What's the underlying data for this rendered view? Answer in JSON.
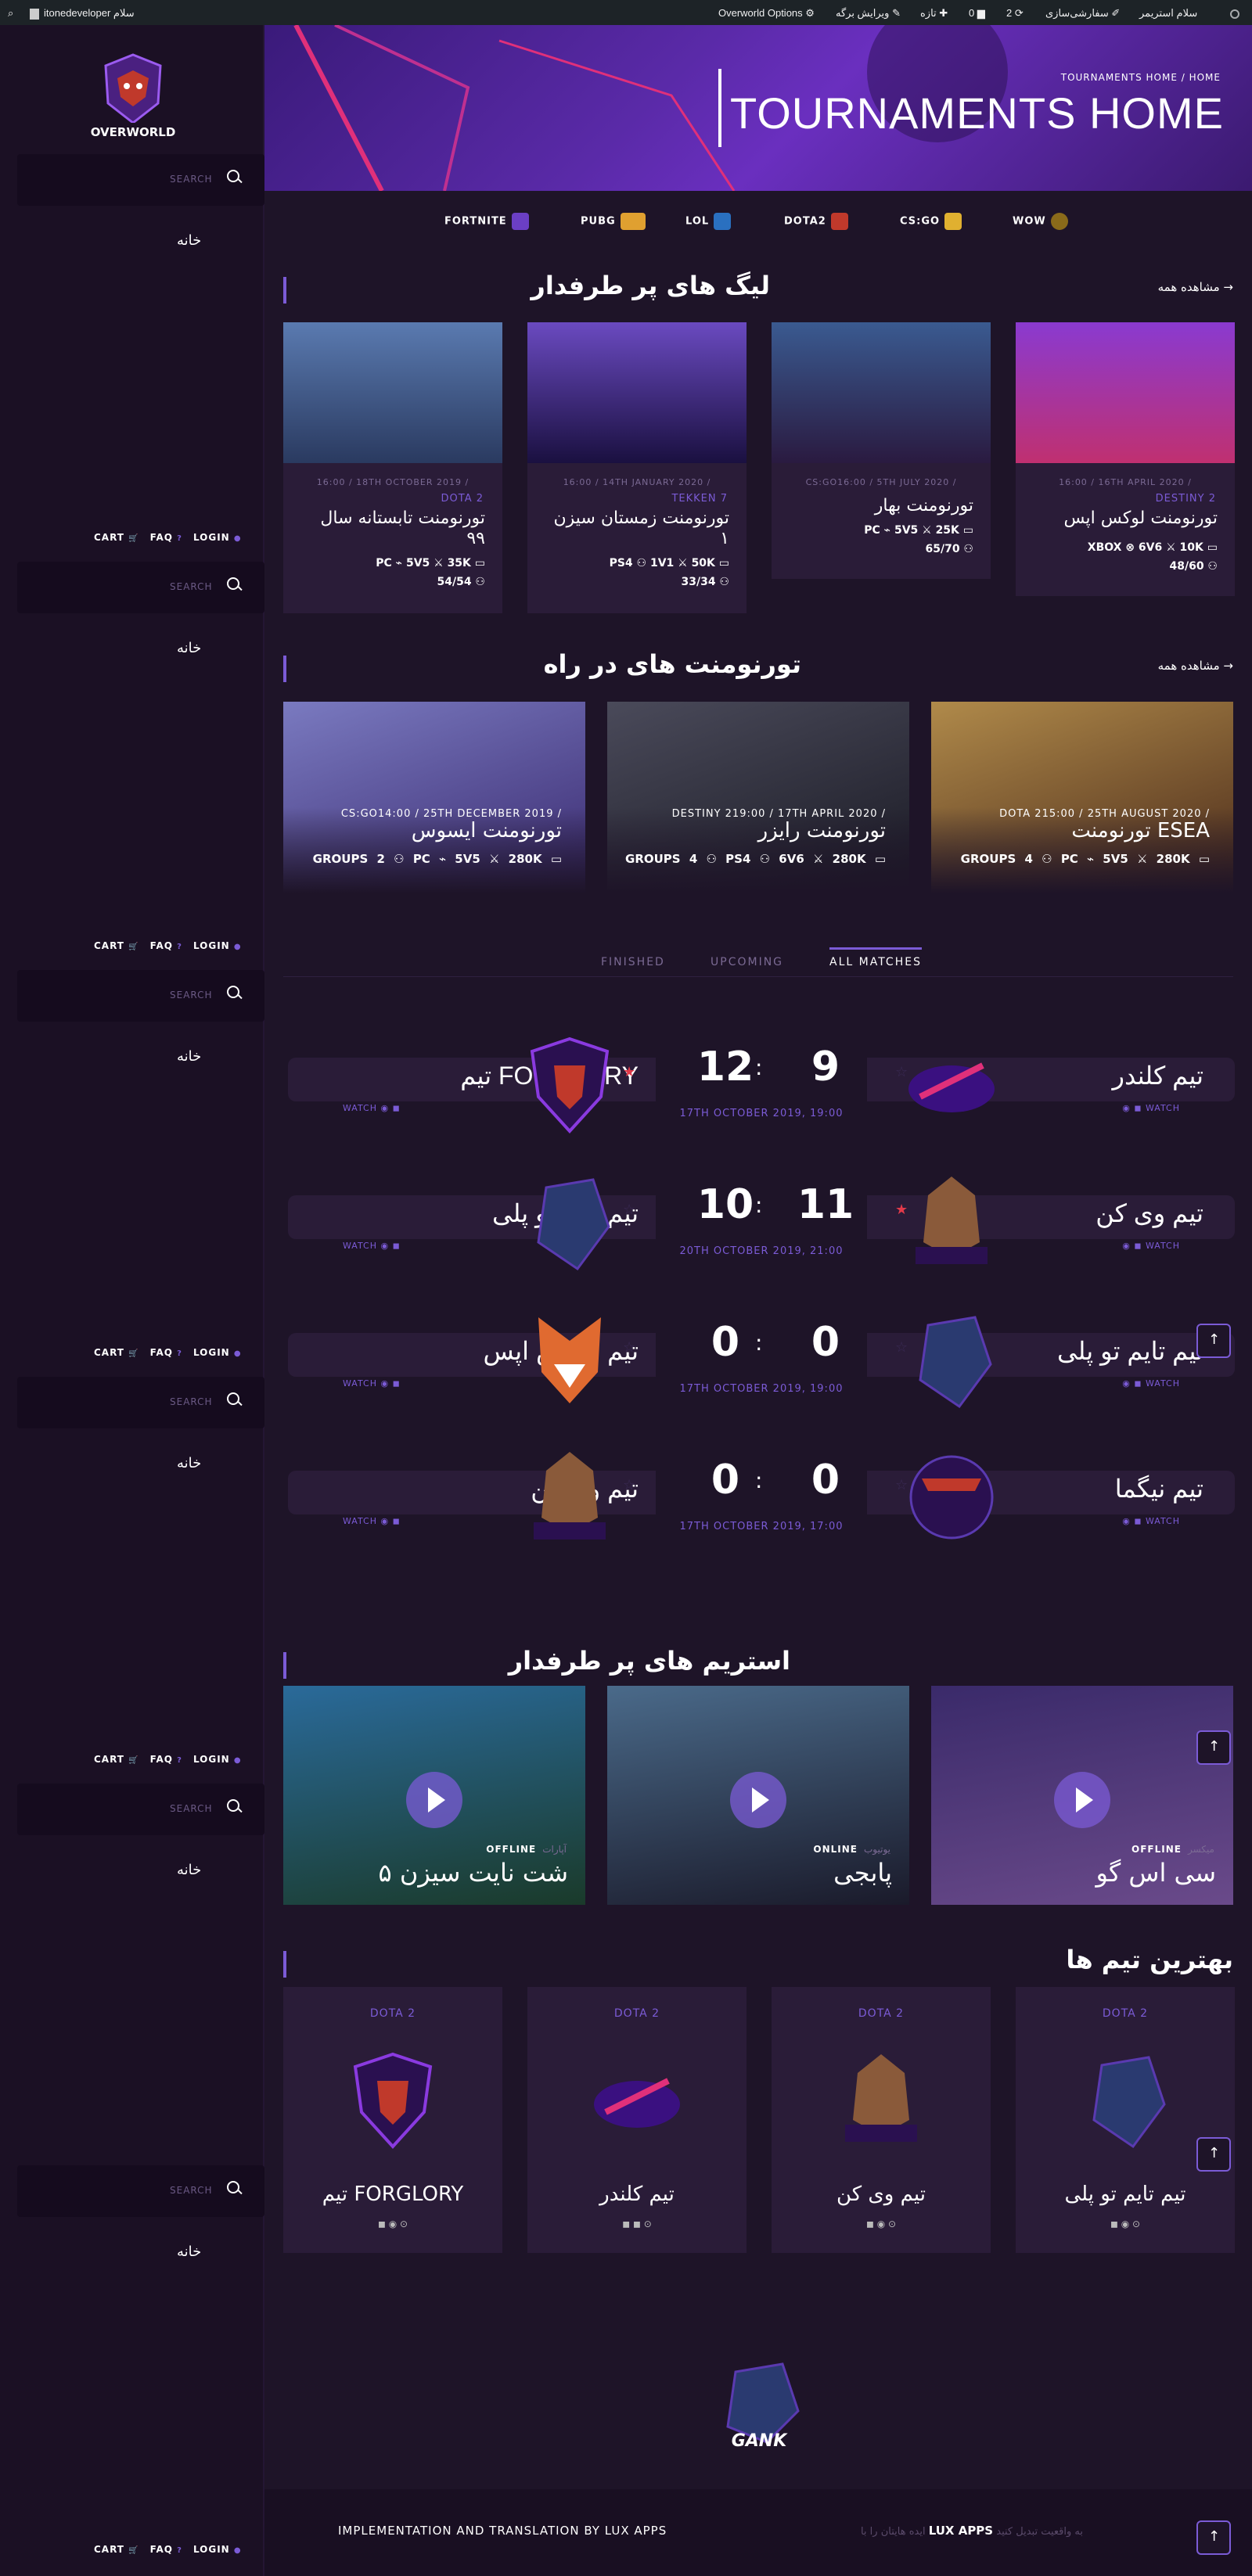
{
  "adminbar": {
    "site": "itonedeveloper سلام",
    "options": "Overworld Options",
    "edit": "ویرایش برگه",
    "new": "تازه",
    "comments": "0",
    "updates": "2",
    "customize": "سفارشی‌سازی",
    "greeting": "سلام استریمر"
  },
  "sidebar": {
    "search_placeholder": "SEARCH",
    "home": "خانه",
    "cart": "CART",
    "faq": "FAQ",
    "login": "LOGIN",
    "logo_text": "OVERWORLD"
  },
  "hero": {
    "breadcrumb": "TOURNAMENTS HOME / HOME",
    "title": "TOURNAMENTS HOME"
  },
  "games": [
    "FORTNITE",
    "PUBG",
    "LOL",
    "DOTA2",
    "CS:GO",
    "WOW"
  ],
  "leagues": {
    "title": "لیگ های پر طرفدار",
    "see_all": "مشاهده همه",
    "cards": [
      {
        "meta": "16:00 / 18TH OCTOBER 2019 /",
        "game": "DOTA 2",
        "title": "تورنومنت تابستانه سال ۹۹",
        "stats": "PC ⌁   5V5 ⚔   35K ▭",
        "stats2": "54/54 ⚇"
      },
      {
        "meta": "16:00 / 14TH JANUARY 2020 /",
        "game": "TEKKEN 7",
        "title": "تورنومنت زمستان سیزن ۱",
        "stats": "PS4 ⚇   1V1 ⚔   50K ▭",
        "stats2": "33/34 ⚇"
      },
      {
        "meta": "CS:GO16:00 / 5TH JULY 2020 /",
        "game": "",
        "title": "تورنومنت بهار",
        "stats": "PC ⌁   5V5 ⚔   25K ▭",
        "stats2": "65/70 ⚇"
      },
      {
        "meta": "16:00 / 16TH APRIL 2020 /",
        "game": "DESTINY 2",
        "title": "تورنومنت لوکس اپس",
        "stats": "XBOX ⊗   6V6 ⚔   10K ▭",
        "stats2": "48/60 ⚇"
      }
    ]
  },
  "upcoming": {
    "title": "تورنومنت های در راه",
    "see_all": "مشاهده همه",
    "cards": [
      {
        "meta": "CS:GO14:00 / 25TH DECEMBER 2019 /",
        "title": "تورنومنت ایسوس",
        "stats": "GROUPS 2 ⚇  PC ⌁   5V5 ⚔   280K ▭"
      },
      {
        "meta": "DESTINY 219:00 / 17TH APRIL 2020 /",
        "title": "تورنومنت رایزر",
        "stats": "GROUPS 4 ⚇  PS4 ⚇   6V6 ⚔   280K ▭"
      },
      {
        "meta": "DOTA 215:00 / 25TH AUGUST 2020 /",
        "title": "تورنومنت ESEA",
        "stats": "GROUPS 4 ⚇  PC ⌁   5V5 ⚔   280K ▭"
      }
    ]
  },
  "tabs": [
    "FINISHED",
    "UPCOMING",
    "ALL MATCHES"
  ],
  "matches": [
    {
      "left": "تیم FORGLORY",
      "right": "تیم کلندر",
      "ls": "12",
      "rs": "9",
      "date": "17TH OCTOBER 2019, 19:00",
      "watch": "WATCH"
    },
    {
      "left": "تیم تایم تو پلی",
      "right": "تیم وی کن",
      "ls": "10",
      "rs": "11",
      "date": "20TH OCTOBER 2019, 21:00",
      "watch": "WATCH"
    },
    {
      "left": "تیم لوکس اپس",
      "right": "تیم تایم تو پلی",
      "ls": "0",
      "rs": "0",
      "date": "17TH OCTOBER 2019, 19:00",
      "watch": "WATCH"
    },
    {
      "left": "تیم وی کن",
      "right": "تیم نیگما",
      "ls": "0",
      "rs": "0",
      "date": "17TH OCTOBER 2019, 17:00",
      "watch": "WATCH"
    }
  ],
  "streams": {
    "title": "استریم های پر طرفدار",
    "items": [
      {
        "status": "OFFLINE",
        "platform": "آپارات",
        "name": "شت نایت سیزن ۵"
      },
      {
        "status": "ONLINE",
        "platform": "یوتیوب",
        "name": "پابجی"
      },
      {
        "status": "OFFLINE",
        "platform": "میکسر",
        "name": "سی اس گو"
      }
    ]
  },
  "teams": {
    "title": "بهترین تیم ها",
    "items": [
      {
        "game": "DOTA 2",
        "name": "تیم FORGLORY"
      },
      {
        "game": "DOTA 2",
        "name": "تیم کلندر"
      },
      {
        "game": "DOTA 2",
        "name": "تیم وی کن"
      },
      {
        "game": "DOTA 2",
        "name": "تیم تایم تو پلی"
      }
    ]
  },
  "footer": {
    "left": "IMPLEMENTATION AND TRANSLATION BY LUX APPS",
    "right_pre": "ایده هایتان را با",
    "right_brand": "LUX APPS",
    "right_post": "به واقعیت تبدیل کنید",
    "logo_text": "GANK"
  }
}
